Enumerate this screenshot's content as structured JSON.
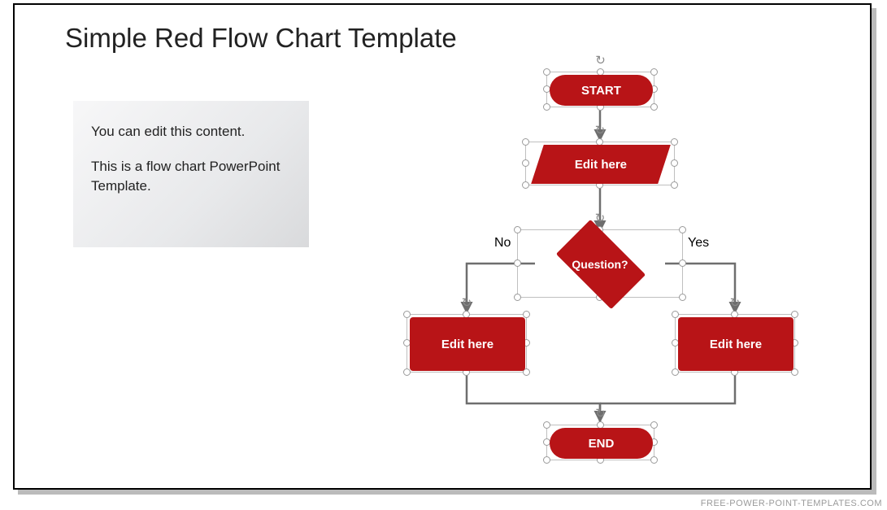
{
  "title": "Simple Red Flow Chart Template",
  "textbox": {
    "line1": "You can edit this content.",
    "line2": "This is a flow chart PowerPoint Template."
  },
  "nodes": {
    "start": "START",
    "input": "Edit here",
    "decision": "Question?",
    "branch_no": "No",
    "branch_yes": "Yes",
    "left_process": "Edit here",
    "right_process": "Edit here",
    "end": "END"
  },
  "watermark": "FREE-POWER-POINT-TEMPLATES.COM",
  "colors": {
    "accent": "#b81417"
  },
  "chart_data": {
    "type": "flowchart",
    "nodes": [
      {
        "id": "start",
        "shape": "terminator",
        "label": "START"
      },
      {
        "id": "input",
        "shape": "parallelogram",
        "label": "Edit here"
      },
      {
        "id": "decision",
        "shape": "diamond",
        "label": "Question?"
      },
      {
        "id": "left",
        "shape": "process",
        "label": "Edit here"
      },
      {
        "id": "right",
        "shape": "process",
        "label": "Edit here"
      },
      {
        "id": "end",
        "shape": "terminator",
        "label": "END"
      }
    ],
    "edges": [
      {
        "from": "start",
        "to": "input"
      },
      {
        "from": "input",
        "to": "decision"
      },
      {
        "from": "decision",
        "to": "left",
        "label": "No"
      },
      {
        "from": "decision",
        "to": "right",
        "label": "Yes"
      },
      {
        "from": "left",
        "to": "end"
      },
      {
        "from": "right",
        "to": "end"
      }
    ]
  }
}
